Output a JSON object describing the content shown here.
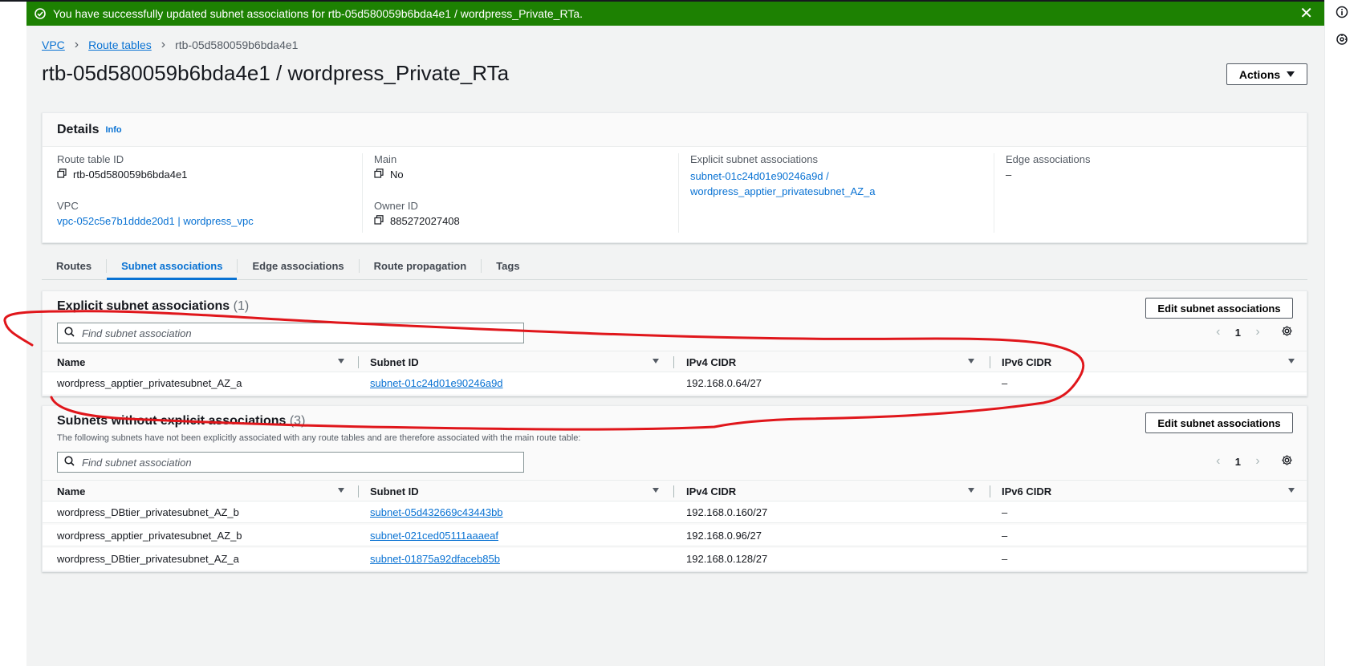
{
  "flash": {
    "message": "You have successfully updated subnet associations for rtb-05d580059b6bda4e1 / wordpress_Private_RTa.",
    "close": "✕"
  },
  "breadcrumb": {
    "items": [
      "VPC",
      "Route tables"
    ],
    "current": "rtb-05d580059b6bda4e1",
    "sep": "›"
  },
  "page": {
    "title": "rtb-05d580059b6bda4e1 / wordpress_Private_RTa",
    "actions_label": "Actions"
  },
  "details": {
    "heading": "Details",
    "info": "Info",
    "route_table_id_label": "Route table ID",
    "route_table_id": "rtb-05d580059b6bda4e1",
    "vpc_label": "VPC",
    "vpc": "vpc-052c5e7b1ddde20d1 | wordpress_vpc",
    "main_label": "Main",
    "main": "No",
    "owner_label": "Owner ID",
    "owner": "885272027408",
    "explicit_label": "Explicit subnet associations",
    "explicit_line1": "subnet-01c24d01e90246a9d /",
    "explicit_line2": "wordpress_apptier_privatesubnet_AZ_a",
    "edge_label": "Edge associations",
    "edge": "–"
  },
  "tabs": [
    "Routes",
    "Subnet associations",
    "Edge associations",
    "Route propagation",
    "Tags"
  ],
  "explicit": {
    "title": "Explicit subnet associations",
    "count": "(1)",
    "edit_label": "Edit subnet associations",
    "search_placeholder": "Find subnet association",
    "page": "1",
    "columns": [
      "Name",
      "Subnet ID",
      "IPv4 CIDR",
      "IPv6 CIDR"
    ],
    "rows": [
      {
        "name": "wordpress_apptier_privatesubnet_AZ_a",
        "subnet": "subnet-01c24d01e90246a9d",
        "ipv4": "192.168.0.64/27",
        "ipv6": "–"
      }
    ]
  },
  "without": {
    "title": "Subnets without explicit associations",
    "count": "(3)",
    "description": "The following subnets have not been explicitly associated with any route tables and are therefore associated with the main route table:",
    "edit_label": "Edit subnet associations",
    "search_placeholder": "Find subnet association",
    "page": "1",
    "columns": [
      "Name",
      "Subnet ID",
      "IPv4 CIDR",
      "IPv6 CIDR"
    ],
    "rows": [
      {
        "name": "wordpress_DBtier_privatesubnet_AZ_b",
        "subnet": "subnet-05d432669c43443bb",
        "ipv4": "192.168.0.160/27",
        "ipv6": "–"
      },
      {
        "name": "wordpress_apptier_privatesubnet_AZ_b",
        "subnet": "subnet-021ced05111aaaeaf",
        "ipv4": "192.168.0.96/27",
        "ipv6": "–"
      },
      {
        "name": "wordpress_DBtier_privatesubnet_AZ_a",
        "subnet": "subnet-01875a92dfaceb85b",
        "ipv4": "192.168.0.128/27",
        "ipv6": "–"
      }
    ]
  },
  "icons": {
    "success": "check-circle-icon",
    "info_rail": "info-icon",
    "rail_second": "settings-circle-icon",
    "copy": "copy-icon",
    "search": "search-icon",
    "gear": "gear-icon"
  },
  "colors": {
    "success_banner": "#1d8102",
    "link": "#0972d3",
    "annotation": "#e0161b"
  }
}
